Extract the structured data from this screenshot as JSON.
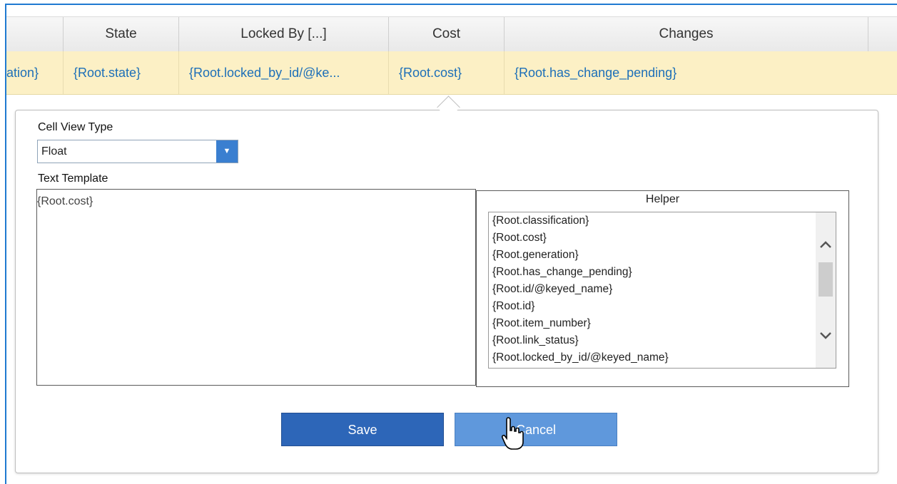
{
  "grid": {
    "headers": [
      {
        "label": ""
      },
      {
        "label": "State"
      },
      {
        "label": "Locked By [...]"
      },
      {
        "label": "Cost"
      },
      {
        "label": "Changes"
      }
    ],
    "selected_row": [
      "ation}",
      "{Root.state}",
      "{Root.locked_by_id/@ke...",
      "{Root.cost}",
      "{Root.has_change_pending}"
    ]
  },
  "popup": {
    "cell_view_type_label": "Cell View Type",
    "cell_view_type_value": "Float",
    "text_template_label": "Text Template",
    "text_template_value": "{Root.cost}",
    "helper_title": "Helper",
    "helper_items": [
      "{Root.classification}",
      "{Root.cost}",
      "{Root.generation}",
      "{Root.has_change_pending}",
      "{Root.id/@keyed_name}",
      "{Root.id}",
      "{Root.item_number}",
      "{Root.link_status}",
      "{Root.locked_by_id/@keyed_name}"
    ],
    "save_label": "Save",
    "cancel_label": "Cancel"
  },
  "icons": {
    "dropdown": "triangle-down-icon",
    "scroll_up": "chevron-up-icon",
    "scroll_down": "chevron-down-icon",
    "cursor": "hand-pointer-icon"
  },
  "colors": {
    "frame_border": "#1f7ad1",
    "selected_row": "#fcf0c5",
    "link_text": "#1d6fb8",
    "save_button": "#2d66b8",
    "cancel_button": "#5f98dc"
  }
}
